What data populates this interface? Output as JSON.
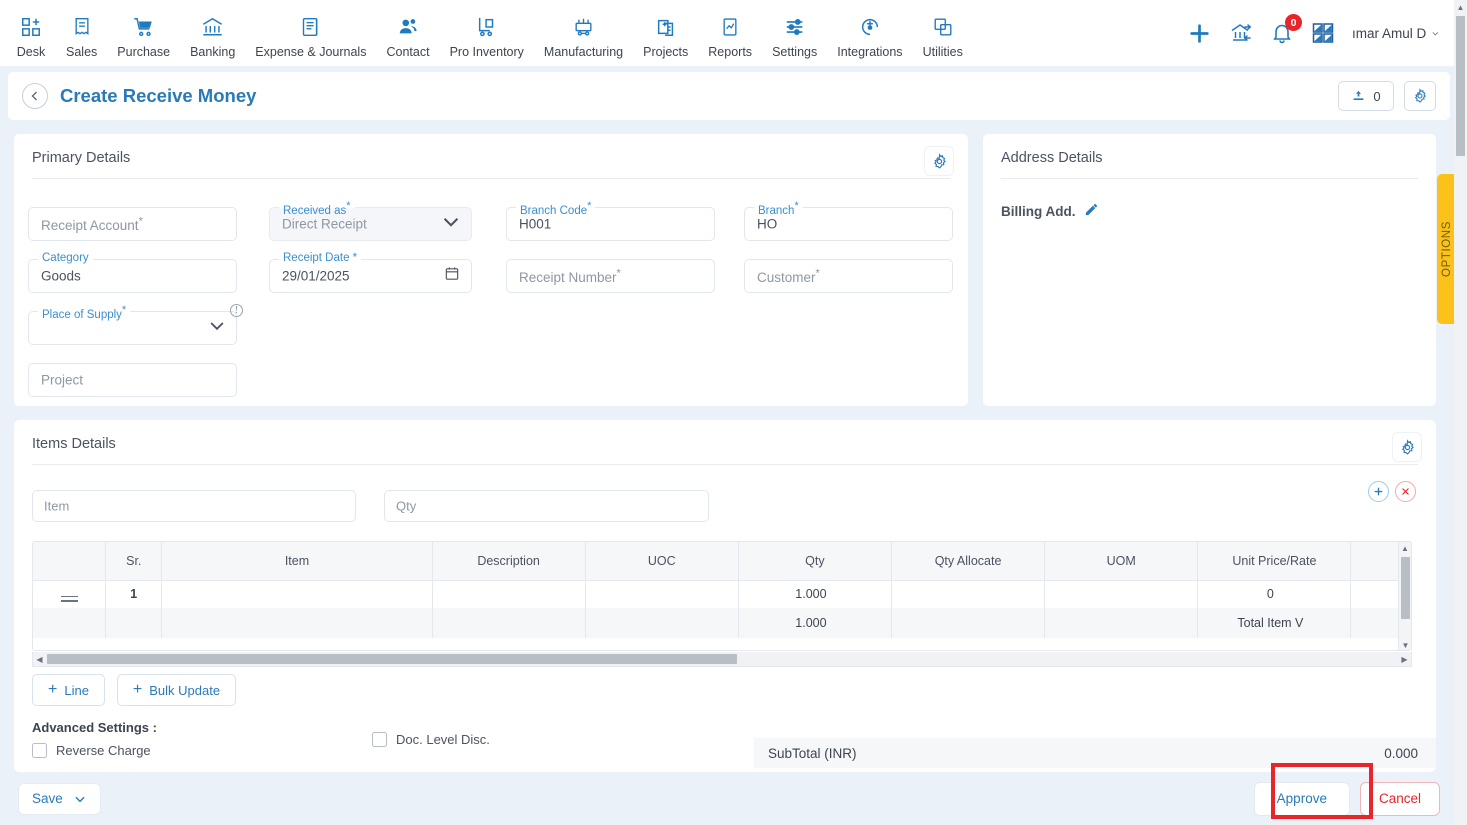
{
  "topnav": {
    "items": [
      {
        "label": "Desk",
        "icon": "dashboard-grid-icon"
      },
      {
        "label": "Sales",
        "icon": "receipt-icon"
      },
      {
        "label": "Purchase",
        "icon": "shopping-cart-icon"
      },
      {
        "label": "Banking",
        "icon": "bank-building-icon"
      },
      {
        "label": "Expense & Journals",
        "icon": "journal-book-icon"
      },
      {
        "label": "Contact",
        "icon": "people-icon"
      },
      {
        "label": "Pro Inventory",
        "icon": "hand-truck-icon"
      },
      {
        "label": "Manufacturing",
        "icon": "factory-machine-icon"
      },
      {
        "label": "Projects",
        "icon": "clipboard-plus-icon"
      },
      {
        "label": "Reports",
        "icon": "chart-document-icon"
      },
      {
        "label": "Settings",
        "icon": "sliders-icon"
      },
      {
        "label": "Integrations",
        "icon": "plug-circle-icon"
      },
      {
        "label": "Utilities",
        "icon": "swap-images-icon"
      }
    ],
    "actions": {
      "add": "plus-icon",
      "bank_transfer": "bank-transfer-icon",
      "notifications_icon": "bell-icon",
      "notifications_count": "0",
      "apps": "apps-grid-icon"
    },
    "user": {
      "name": "ımar Amul D",
      "chevron": "chevron-down-icon"
    }
  },
  "header": {
    "back": "chevron-left-icon",
    "title": "Create Receive Money",
    "attachment_icon": "upload-person-icon",
    "attachment_count": "0",
    "settings_icon": "gear-icon"
  },
  "primary": {
    "title": "Primary Details",
    "gear_icon": "gear-icon",
    "fields": {
      "receipt_account": {
        "placeholder": "Receipt Account",
        "required": "*",
        "value": ""
      },
      "received_as": {
        "label": "Received as",
        "required": "*",
        "value": "Direct Receipt",
        "chevron": "chevron-down-icon"
      },
      "branch_code": {
        "label": "Branch Code",
        "required": "*",
        "value": "H001"
      },
      "branch": {
        "label": "Branch",
        "required": "*",
        "value": "HO"
      },
      "category": {
        "label": "Category",
        "value": "Goods"
      },
      "receipt_date": {
        "label": "Receipt Date *",
        "value": "29/01/2025",
        "icon": "calendar-icon"
      },
      "receipt_number": {
        "placeholder": "Receipt Number",
        "required": "*",
        "value": ""
      },
      "customer": {
        "placeholder": "Customer",
        "required": "*",
        "value": ""
      },
      "place_of_supply": {
        "label": "Place of Supply",
        "required": "*",
        "value": "",
        "info": "!",
        "chevron": "chevron-down-icon"
      },
      "project": {
        "placeholder": "Project",
        "value": ""
      }
    }
  },
  "address": {
    "title": "Address Details",
    "billing_label": "Billing Add.",
    "edit_icon": "pencil-icon"
  },
  "options_tab": {
    "label": "OPTIONS"
  },
  "items": {
    "title": "Items Details",
    "gear_icon": "gear-icon",
    "search": {
      "item_placeholder": "Item",
      "qty_placeholder": "Qty"
    },
    "columns": [
      "",
      "Sr.",
      "Item",
      "Description",
      "UOC",
      "Qty",
      "Qty Allocate",
      "UOM",
      "Unit Price/Rate",
      ""
    ],
    "rows": [
      {
        "handle": "drag-handle-icon",
        "sr": "1",
        "item": "",
        "description": "",
        "uoc": "",
        "qty": "1.000",
        "qty_allocate": "",
        "uom": "",
        "unit_price": "0",
        "add_icon": "plus-icon",
        "delete_icon": "close-icon"
      }
    ],
    "total_row": {
      "qty": "1.000",
      "label": "Total Item V"
    },
    "buttons": {
      "line": "Line",
      "bulk_update": "Bulk Update"
    },
    "advanced": {
      "title": "Advanced Settings :",
      "reverse_charge": "Reverse Charge",
      "doc_level_disc": "Doc. Level Disc."
    },
    "subtotal": {
      "label": "SubTotal (INR)",
      "value": "0.000"
    }
  },
  "footer": {
    "save": "Save",
    "save_chevron": "chevron-down-icon",
    "approve": "Approve",
    "cancel": "Cancel"
  },
  "colors": {
    "accent": "#2a7ab9",
    "label": "#3a8fd0",
    "danger": "#e8252b",
    "options_tab": "#fcc21b",
    "page_bg": "#eaf1f8"
  }
}
